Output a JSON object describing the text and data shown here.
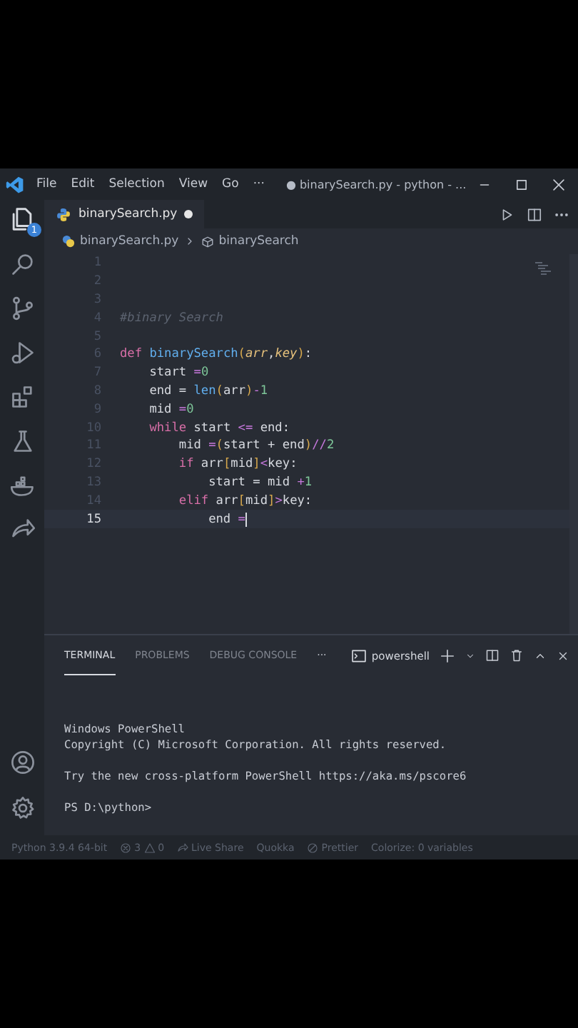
{
  "title_bar": {
    "menu": [
      "File",
      "Edit",
      "Selection",
      "View",
      "Go",
      "···"
    ],
    "title": "● binarySearch.py - python - ..."
  },
  "activity_bar": {
    "explorer_badge": "1"
  },
  "editor_tab": {
    "label": "binarySearch.py",
    "modified": true
  },
  "breadcrumbs": [
    "binarySearch.py",
    "binarySearch"
  ],
  "code_lines": [
    {
      "number": "1",
      "current": false
    },
    {
      "number": "2",
      "current": false
    },
    {
      "number": "3",
      "current": false
    },
    {
      "number": "4",
      "current": false,
      "tokens": [
        {
          "text": "#binary Search",
          "kind": "comment"
        }
      ]
    },
    {
      "number": "5",
      "current": false
    },
    {
      "number": "6",
      "current": false,
      "tokens": [
        {
          "text": "def ",
          "kind": "keyword"
        },
        {
          "text": "binarySearch",
          "kind": "function"
        },
        {
          "text": "(",
          "kind": "bracket"
        },
        {
          "text": "arr",
          "kind": "param"
        },
        {
          "text": ",",
          "kind": "plain"
        },
        {
          "text": "key",
          "kind": "param"
        },
        {
          "text": ")",
          "kind": "bracket"
        },
        {
          "text": ":",
          "kind": "plain"
        }
      ]
    },
    {
      "number": "7",
      "current": false,
      "tokens": [
        {
          "text": "    start ",
          "kind": "plain"
        },
        {
          "text": "=",
          "kind": "operator"
        },
        {
          "text": "0",
          "kind": "number"
        }
      ]
    },
    {
      "number": "8",
      "current": false,
      "tokens": [
        {
          "text": "    end = ",
          "kind": "plain"
        },
        {
          "text": "len",
          "kind": "builtin"
        },
        {
          "text": "(",
          "kind": "bracket"
        },
        {
          "text": "arr",
          "kind": "plain"
        },
        {
          "text": ")",
          "kind": "bracket"
        },
        {
          "text": "-",
          "kind": "operator"
        },
        {
          "text": "1",
          "kind": "number"
        }
      ]
    },
    {
      "number": "9",
      "current": false,
      "tokens": [
        {
          "text": "    mid ",
          "kind": "plain"
        },
        {
          "text": "=",
          "kind": "operator"
        },
        {
          "text": "0",
          "kind": "number"
        }
      ]
    },
    {
      "number": "10",
      "current": false,
      "tokens": [
        {
          "text": "    while",
          "kind": "keyword"
        },
        {
          "text": " start ",
          "kind": "plain"
        },
        {
          "text": "<=",
          "kind": "operator"
        },
        {
          "text": " end:",
          "kind": "plain"
        }
      ]
    },
    {
      "number": "11",
      "current": false,
      "tokens": [
        {
          "text": "        mid ",
          "kind": "plain"
        },
        {
          "text": "=",
          "kind": "operator"
        },
        {
          "text": "(",
          "kind": "bracket"
        },
        {
          "text": "start + end",
          "kind": "plain"
        },
        {
          "text": ")",
          "kind": "bracket"
        },
        {
          "text": "//",
          "kind": "operator"
        },
        {
          "text": "2",
          "kind": "number"
        }
      ]
    },
    {
      "number": "12",
      "current": false,
      "tokens": [
        {
          "text": "        if",
          "kind": "keyword"
        },
        {
          "text": " arr",
          "kind": "plain"
        },
        {
          "text": "[",
          "kind": "bracket"
        },
        {
          "text": "mid",
          "kind": "plain"
        },
        {
          "text": "]",
          "kind": "bracket"
        },
        {
          "text": "<",
          "kind": "operator"
        },
        {
          "text": "key:",
          "kind": "plain"
        }
      ]
    },
    {
      "number": "13",
      "current": false,
      "tokens": [
        {
          "text": "            start = mid ",
          "kind": "plain"
        },
        {
          "text": "+",
          "kind": "operator"
        },
        {
          "text": "1",
          "kind": "number"
        }
      ]
    },
    {
      "number": "14",
      "current": false,
      "tokens": [
        {
          "text": "        elif",
          "kind": "keyword"
        },
        {
          "text": " arr",
          "kind": "plain"
        },
        {
          "text": "[",
          "kind": "bracket"
        },
        {
          "text": "mid",
          "kind": "plain"
        },
        {
          "text": "]",
          "kind": "bracket"
        },
        {
          "text": ">",
          "kind": "operator"
        },
        {
          "text": "key:",
          "kind": "plain"
        }
      ]
    },
    {
      "number": "15",
      "current": true,
      "tokens": [
        {
          "text": "            end ",
          "kind": "plain"
        },
        {
          "text": "=",
          "kind": "operator"
        }
      ]
    }
  ],
  "panel": {
    "tabs": [
      {
        "label": "TERMINAL",
        "selected": true
      },
      {
        "label": "PROBLEMS",
        "selected": false
      },
      {
        "label": "DEBUG CONSOLE",
        "selected": false
      }
    ],
    "more": "···",
    "shell": "powershell",
    "terminal_paragraphs": [
      [
        "Windows PowerShell",
        "Copyright (C) Microsoft Corporation. All rights reserved."
      ],
      [
        "Try the new cross-platform PowerShell https://aka.ms/pscore6"
      ],
      [
        "PS D:\\python>"
      ]
    ]
  },
  "status_bar": {
    "python": "Python 3.9.4 64-bit",
    "errors": "3",
    "warnings": "0",
    "items": [
      "Live Share",
      "Quokka",
      "Prettier",
      "Colorize: 0 variables"
    ]
  }
}
